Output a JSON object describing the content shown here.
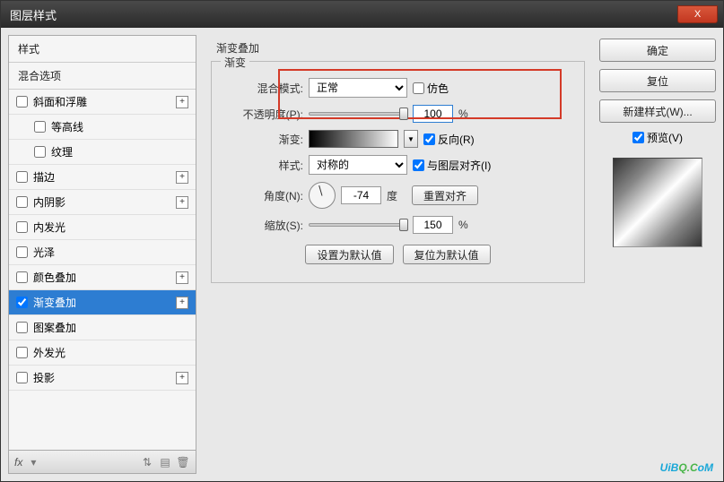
{
  "title": "图层样式",
  "close": "X",
  "left": {
    "styles_header": "样式",
    "blend_header": "混合选项",
    "items": [
      {
        "label": "斜面和浮雕",
        "indent": false,
        "plus": true,
        "checked": false
      },
      {
        "label": "等高线",
        "indent": true,
        "plus": false,
        "checked": false
      },
      {
        "label": "纹理",
        "indent": true,
        "plus": false,
        "checked": false
      },
      {
        "label": "描边",
        "indent": false,
        "plus": true,
        "checked": false
      },
      {
        "label": "内阴影",
        "indent": false,
        "plus": true,
        "checked": false
      },
      {
        "label": "内发光",
        "indent": false,
        "plus": false,
        "checked": false
      },
      {
        "label": "光泽",
        "indent": false,
        "plus": false,
        "checked": false
      },
      {
        "label": "颜色叠加",
        "indent": false,
        "plus": true,
        "checked": false
      },
      {
        "label": "渐变叠加",
        "indent": false,
        "plus": true,
        "checked": true,
        "selected": true
      },
      {
        "label": "图案叠加",
        "indent": false,
        "plus": false,
        "checked": false
      },
      {
        "label": "外发光",
        "indent": false,
        "plus": false,
        "checked": false
      },
      {
        "label": "投影",
        "indent": false,
        "plus": true,
        "checked": false
      }
    ],
    "fx": "fx"
  },
  "center": {
    "group_title": "渐变叠加",
    "fieldset_label": "渐变",
    "blend_mode_label": "混合模式:",
    "blend_mode_value": "正常",
    "dither_label": "仿色",
    "opacity_label": "不透明度(P):",
    "opacity_value": "100",
    "opacity_unit": "%",
    "gradient_label": "渐变:",
    "reverse_label": "反向(R)",
    "style_label": "样式:",
    "style_value": "对称的",
    "align_label": "与图层对齐(I)",
    "angle_label": "角度(N):",
    "angle_value": "-74",
    "angle_unit": "度",
    "reset_align": "重置对齐",
    "scale_label": "缩放(S):",
    "scale_value": "150",
    "scale_unit": "%",
    "set_default": "设置为默认值",
    "reset_default": "复位为默认值"
  },
  "right": {
    "ok": "确定",
    "reset": "复位",
    "new_style": "新建样式(W)...",
    "preview_label": "预览(V)"
  },
  "watermark": {
    "a": "UiB",
    "b": "Q.C",
    "c": "oM"
  }
}
